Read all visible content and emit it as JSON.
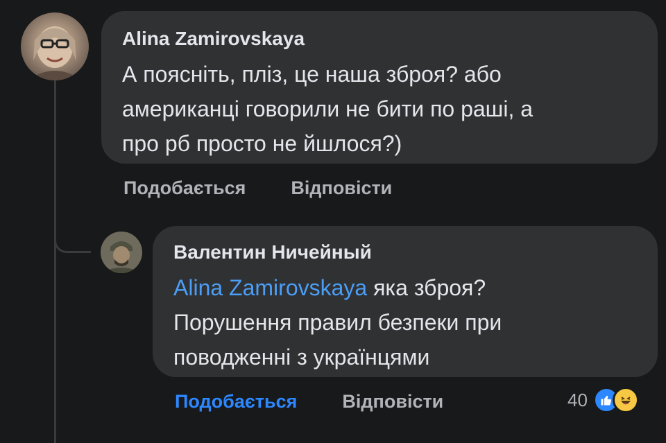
{
  "comment1": {
    "author": "Alina Zamirovskaya",
    "text_lines": [
      "А поясніть, пліз, це наша зброя? або",
      "американці говорили не бити по раші, а",
      "про рб просто не йшлося?)"
    ],
    "actions": {
      "like": "Подобається",
      "reply": "Відповісти"
    }
  },
  "comment2": {
    "author": "Валентин Ничейный",
    "mention": "Alina Zamirovskaya",
    "text_line1_rest": " яка зброя?",
    "text_lines": [
      "Порушення правил безпеки при",
      "поводженні з українцями"
    ],
    "actions": {
      "like": "Подобається",
      "reply": "Відповісти"
    },
    "reactions": {
      "count": "40",
      "icons": [
        "like-icon",
        "haha-icon"
      ]
    }
  },
  "colors": {
    "background": "#18191a",
    "bubble": "#303133",
    "text": "#e4e6eb",
    "secondary_text": "#b0b3b8",
    "accent_blue": "#2d88ff",
    "mention_blue": "#4b9ef6"
  }
}
